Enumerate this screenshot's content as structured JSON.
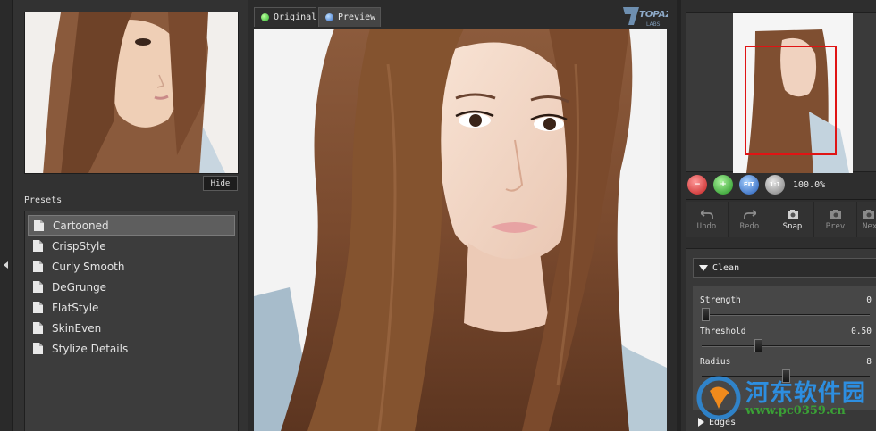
{
  "left": {
    "hide_label": "Hide",
    "presets_label": "Presets",
    "presets": [
      {
        "label": "Cartooned",
        "selected": true
      },
      {
        "label": "CrispStyle",
        "selected": false
      },
      {
        "label": "Curly Smooth",
        "selected": false
      },
      {
        "label": "DeGrunge",
        "selected": false
      },
      {
        "label": "FlatStyle",
        "selected": false
      },
      {
        "label": "SkinEven",
        "selected": false
      },
      {
        "label": "Stylize Details",
        "selected": false
      }
    ]
  },
  "center": {
    "tabs": [
      {
        "label": "Original",
        "icon": "green-dot-icon",
        "active": false
      },
      {
        "label": "Preview",
        "icon": "blue-dot-icon",
        "active": true
      }
    ],
    "logo_text": "TOPAZ LABS"
  },
  "right": {
    "zoom": {
      "out": "−",
      "in": "+",
      "fit": "FIT",
      "actual": "1:1",
      "percent": "100.0%"
    },
    "history": [
      {
        "label": "Undo",
        "icon": "undo-icon",
        "enabled": false
      },
      {
        "label": "Redo",
        "icon": "redo-icon",
        "enabled": false
      },
      {
        "label": "Snap",
        "icon": "camera-icon",
        "enabled": true
      },
      {
        "label": "Prev",
        "icon": "camera-icon",
        "enabled": false
      },
      {
        "label": "Next",
        "icon": "camera-icon",
        "enabled": false
      }
    ],
    "sections": {
      "clean": {
        "title": "Clean",
        "params": [
          {
            "label": "Strength",
            "value": "0",
            "fraction": 0.0
          },
          {
            "label": "Threshold",
            "value": "0.50",
            "fraction": 0.33
          },
          {
            "label": "Radius",
            "value": "8",
            "fraction": 0.5
          }
        ]
      },
      "edges": {
        "title": "Edges"
      }
    }
  },
  "watermark": {
    "cn": "河东软件园",
    "url": "www.pc0359.cn"
  },
  "colors": {
    "accent_selection": "#5e5e5e",
    "nav_rect": "#e01414",
    "panel": "#323232"
  }
}
